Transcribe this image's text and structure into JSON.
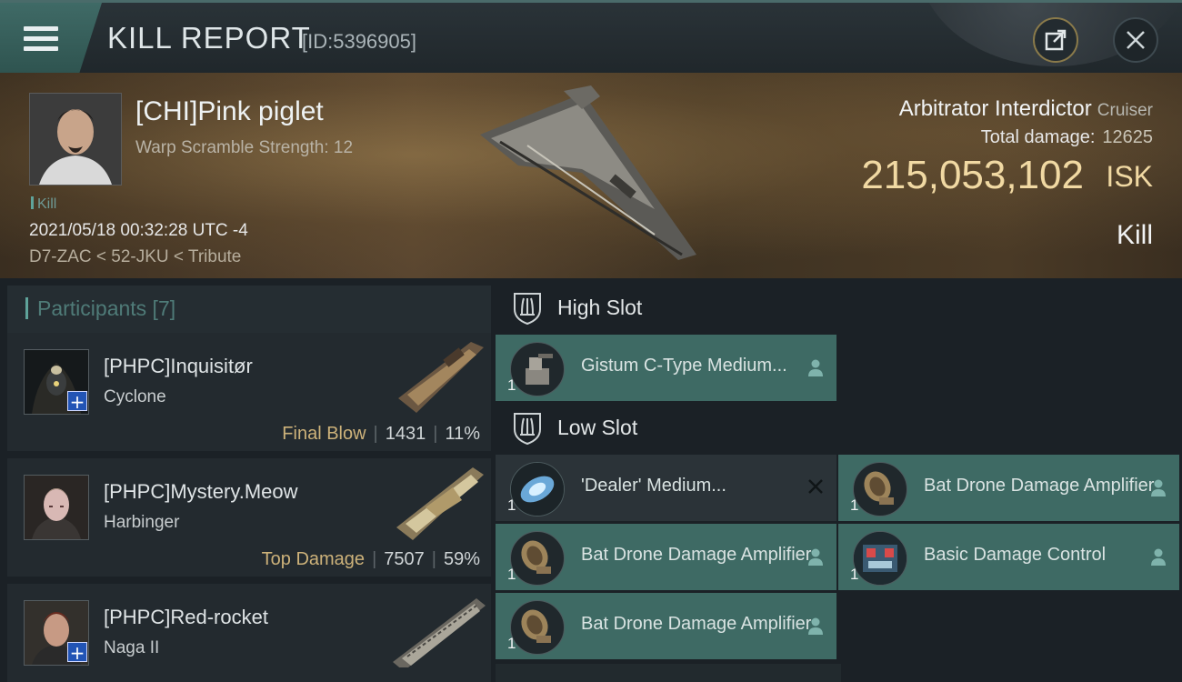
{
  "header": {
    "title": "KILL REPORT",
    "id_label": "[ID:5396905]"
  },
  "victim": {
    "name": "[CHI]Pink piglet",
    "subtitle": "Warp Scramble Strength: 12",
    "tag": "Kill",
    "datetime": "2021/05/18 00:32:28 UTC -4",
    "location": "D7-ZAC < 52-JKU < Tribute",
    "ship_name": "Arbitrator Interdictor",
    "ship_class": "Cruiser",
    "total_damage_label": "Total damage:",
    "total_damage_value": "12625",
    "isk_value": "215,053,102",
    "isk_unit": "ISK",
    "result": "Kill"
  },
  "participants": {
    "title": "Participants [7]",
    "items": [
      {
        "name": "[PHPC]Inquisitør",
        "ship": "Cyclone",
        "tag": "Final Blow",
        "damage": "1431",
        "percent": "11%"
      },
      {
        "name": "[PHPC]Mystery.Meow",
        "ship": "Harbinger",
        "tag": "Top Damage",
        "damage": "7507",
        "percent": "59%"
      },
      {
        "name": "[PHPC]Red-rocket",
        "ship": "Naga II",
        "tag": "",
        "damage": "",
        "percent": ""
      }
    ]
  },
  "slots": {
    "high": {
      "title": "High Slot",
      "modules": [
        {
          "name": "Gistum C-Type Medium...",
          "qty": "1"
        }
      ]
    },
    "low": {
      "title": "Low Slot",
      "modules": [
        {
          "name": "'Dealer' Medium...",
          "qty": "1"
        },
        {
          "name": "Bat Drone Damage Amplifier",
          "qty": "1"
        },
        {
          "name": "Bat Drone Damage Amplifier",
          "qty": "1"
        },
        {
          "name": "Basic Damage Control",
          "qty": "1"
        },
        {
          "name": "Bat Drone Damage Amplifier",
          "qty": "1"
        }
      ]
    }
  },
  "colors": {
    "accent_teal": "#3e6a64",
    "isk_gold": "#f1d9a3",
    "tag_gold": "#cdb27a",
    "background": "#1b2126"
  },
  "icons": [
    "menu-icon",
    "share-icon",
    "close-icon",
    "shield-icon",
    "person-icon",
    "x-icon",
    "plus-icon"
  ]
}
